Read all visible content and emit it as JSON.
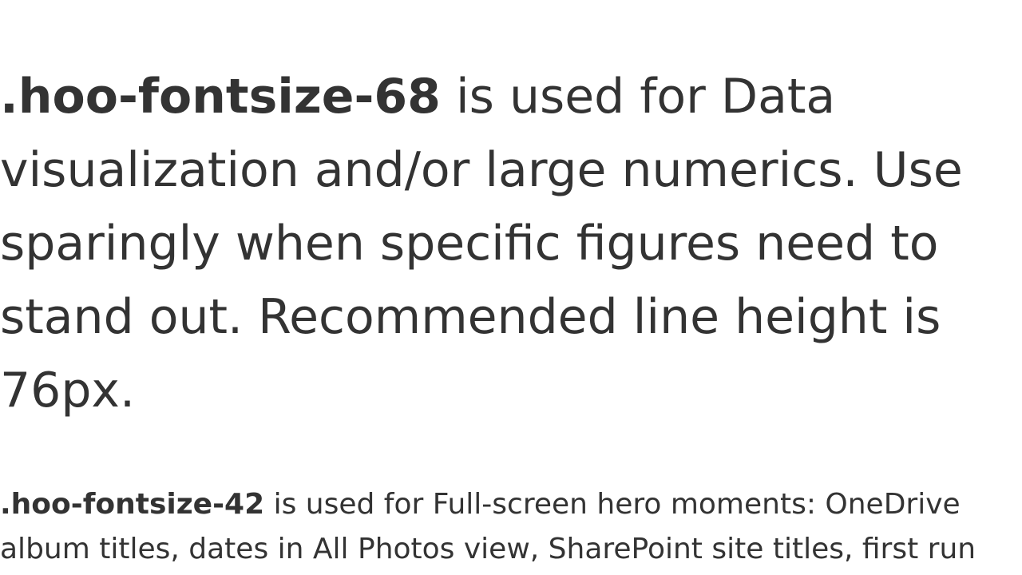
{
  "sections": [
    {
      "class_name": ".hoo-fontsize-68",
      "lines": [
        " is used for Data",
        "visualization and/or large numerics. Use",
        "sparingly when specific figures need to",
        "stand out. Recommended line height is",
        "76px."
      ]
    },
    {
      "class_name": ".hoo-fontsize-42",
      "lines": [
        " is used for Full-screen hero moments: OneDrive",
        "album titles, dates in All Photos view, SharePoint site titles, first run"
      ]
    }
  ]
}
